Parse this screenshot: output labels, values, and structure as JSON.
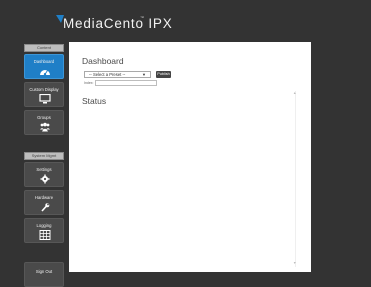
{
  "app": {
    "logo_text": "MediaCento",
    "logo_suffix": "IPX",
    "trademark": "™"
  },
  "sidebar": {
    "sections": [
      {
        "header": "Content"
      },
      {
        "header": "System Mgmt"
      }
    ],
    "items": [
      {
        "label": "Dashboard",
        "icon": "dashboard-icon",
        "active": true
      },
      {
        "label": "Custom Display",
        "icon": "monitor-icon",
        "active": false
      },
      {
        "label": "Groups",
        "icon": "users-icon",
        "active": false
      },
      {
        "label": "Settings",
        "icon": "gear-icon",
        "active": false
      },
      {
        "label": "Hardware",
        "icon": "wrench-icon",
        "active": false
      },
      {
        "label": "Logging",
        "icon": "table-icon",
        "active": false
      },
      {
        "label": "Sign Out",
        "icon": "",
        "active": false
      }
    ]
  },
  "main": {
    "title": "Dashboard",
    "preset_select": {
      "selected": "-- Select a Preset --"
    },
    "publish_label": "Publish",
    "index_label": "Index:",
    "index_value": "",
    "status_title": "Status"
  },
  "colors": {
    "accent": "#1f7fc7",
    "sidebar_item": "#4a4a4a",
    "background": "#333333",
    "logo_mark": "#1f7fc7"
  }
}
